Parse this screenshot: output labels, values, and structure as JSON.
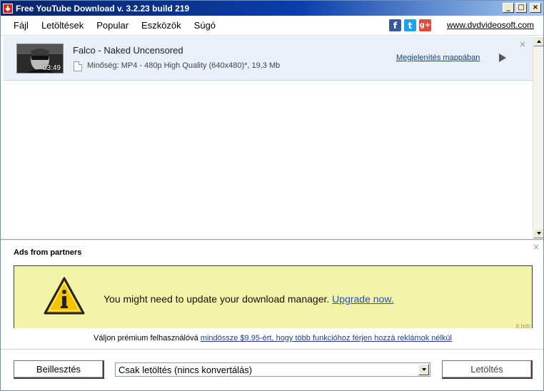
{
  "window": {
    "title": "Free YouTube Download  v. 3.2.23 build 219",
    "controls": [
      "_",
      "□",
      "×"
    ]
  },
  "menu": {
    "items": [
      "Fájl",
      "Letöltések",
      "Popular",
      "Eszközök",
      "Súgó"
    ],
    "socials": [
      {
        "name": "facebook-icon",
        "glyph": "f",
        "color": "#3b5998"
      },
      {
        "name": "twitter-icon",
        "glyph": "t",
        "color": "#1da1f2"
      },
      {
        "name": "google-plus-icon",
        "glyph": "g+",
        "color": "#dd4b39"
      }
    ],
    "site_link": "www.dvdvideosoft.com"
  },
  "downloads": [
    {
      "title": "Falco - Naked Uncensored",
      "duration": "03:49",
      "quality": "Minőség: MP4 - 480p High Quality (640x480)*, 19,3 Mb",
      "show_folder": "Megjelenítés mappában",
      "close": "×"
    }
  ],
  "ads": {
    "header": "Ads from partners",
    "close": "×",
    "message": "You might need to update your download manager.",
    "link": "Upgrade now.",
    "corner": "it.bdc",
    "background": "#f4f4a8"
  },
  "premium": {
    "text": "Váljon prémium felhasználóvá",
    "link": "mindössze $9.95-ért, hogy több funkcióhoz férjen hozzá reklámok nélkül"
  },
  "bottom": {
    "paste": "Beillesztés",
    "format_selected": "Csak letöltés (nincs konvertálás)",
    "download": "Letöltés"
  }
}
